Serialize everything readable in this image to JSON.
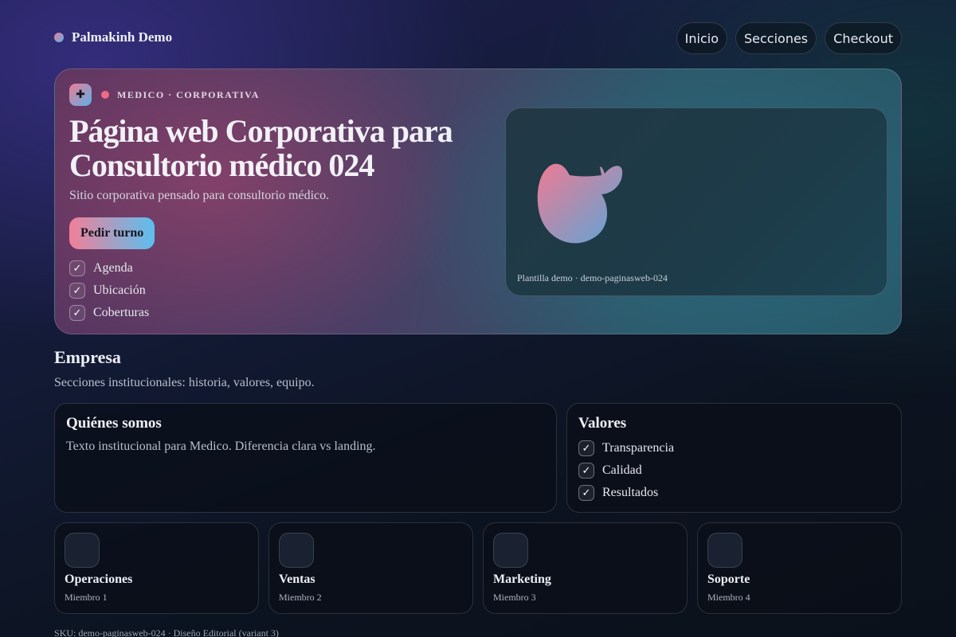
{
  "header": {
    "brand": "Palmakinh Demo",
    "nav": [
      "Inicio",
      "Secciones",
      "Checkout"
    ]
  },
  "hero": {
    "badge_icon": "medical-cross-icon",
    "tag": "MEDICO · CORPORATIVA",
    "title": "Página web Corporativa para Consultorio médico 024",
    "subtitle": "Sitio corporativa pensado para consultorio médico.",
    "cta": "Pedir turno",
    "features": [
      "Agenda",
      "Ubicación",
      "Coberturas"
    ],
    "preview_caption": "Plantilla demo · demo-paginasweb-024"
  },
  "section": {
    "title": "Empresa",
    "subtitle": "Secciones institucionales: historia, valores, equipo."
  },
  "about": {
    "title": "Quiénes somos",
    "text": "Texto institucional para Medico. Diferencia clara vs landing."
  },
  "values": {
    "title": "Valores",
    "items": [
      "Transparencia",
      "Calidad",
      "Resultados"
    ]
  },
  "team": [
    {
      "name": "Operaciones",
      "role": "Miembro 1"
    },
    {
      "name": "Ventas",
      "role": "Miembro 2"
    },
    {
      "name": "Marketing",
      "role": "Miembro 3"
    },
    {
      "name": "Soporte",
      "role": "Miembro 4"
    }
  ],
  "footer": "SKU: demo-paginasweb-024 · Diseño Editorial (variant 3)",
  "colors": {
    "accent_pink": "#f27f98",
    "accent_blue": "#5bbfee"
  }
}
